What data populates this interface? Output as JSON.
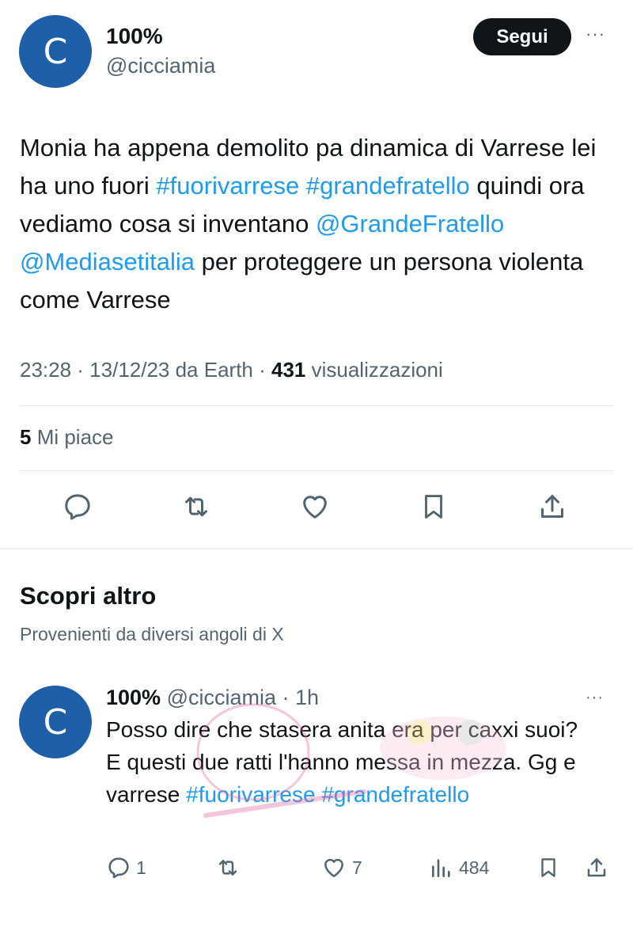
{
  "tweet": {
    "avatar_letter": "C",
    "name": "100%",
    "handle": "@cicciamia",
    "follow_label": "Segui",
    "more_label": "···",
    "text_parts": {
      "p1": "Monia ha appena demolito pa dinamica di Varrese lei ha uno fuori ",
      "tag1": "#fuorivarrese",
      "space1": " ",
      "tag2": "#grandefratello",
      "p2": " quindi ora vediamo cosa si inventano ",
      "mention1": "@GrandeFratello",
      "space2": " ",
      "mention2": "@Mediasetitalia",
      "p3": " per proteggere un persona violenta come Varrese"
    },
    "meta": {
      "time_source": "23:28 · 13/12/23 da Earth · ",
      "views_count": "431",
      "views_label": " visualizzazioni"
    },
    "likes": {
      "count": "5",
      "label": " Mi piace"
    }
  },
  "discover": {
    "title": "Scopri altro",
    "subtitle": "Provenienti da diversi angoli di X"
  },
  "reply_tweet": {
    "avatar_letter": "C",
    "name": "100%",
    "handle_time": " @cicciamia · 1h",
    "more_label": "···",
    "text_parts": {
      "p1": "Posso dire che stasera anita era per caxxi suoi? E questi due ratti l'hanno messa in mezza. Gg e varrese ",
      "tag1": "#fuorivarrese",
      "space1": " ",
      "tag2": "#grandefratello"
    },
    "actions": {
      "replies": "1",
      "likes": "7",
      "views": "484"
    }
  },
  "icons": {
    "reply": "speech-bubble-icon",
    "retweet": "retweet-icon",
    "like": "heart-icon",
    "bookmark": "bookmark-icon",
    "share": "share-icon",
    "views": "bar-chart-icon"
  },
  "colors": {
    "link": "#1d9bf0",
    "text": "#0f1419",
    "muted": "#536471",
    "avatar": "#1d5fa8",
    "follow_button": "#0f1419"
  }
}
